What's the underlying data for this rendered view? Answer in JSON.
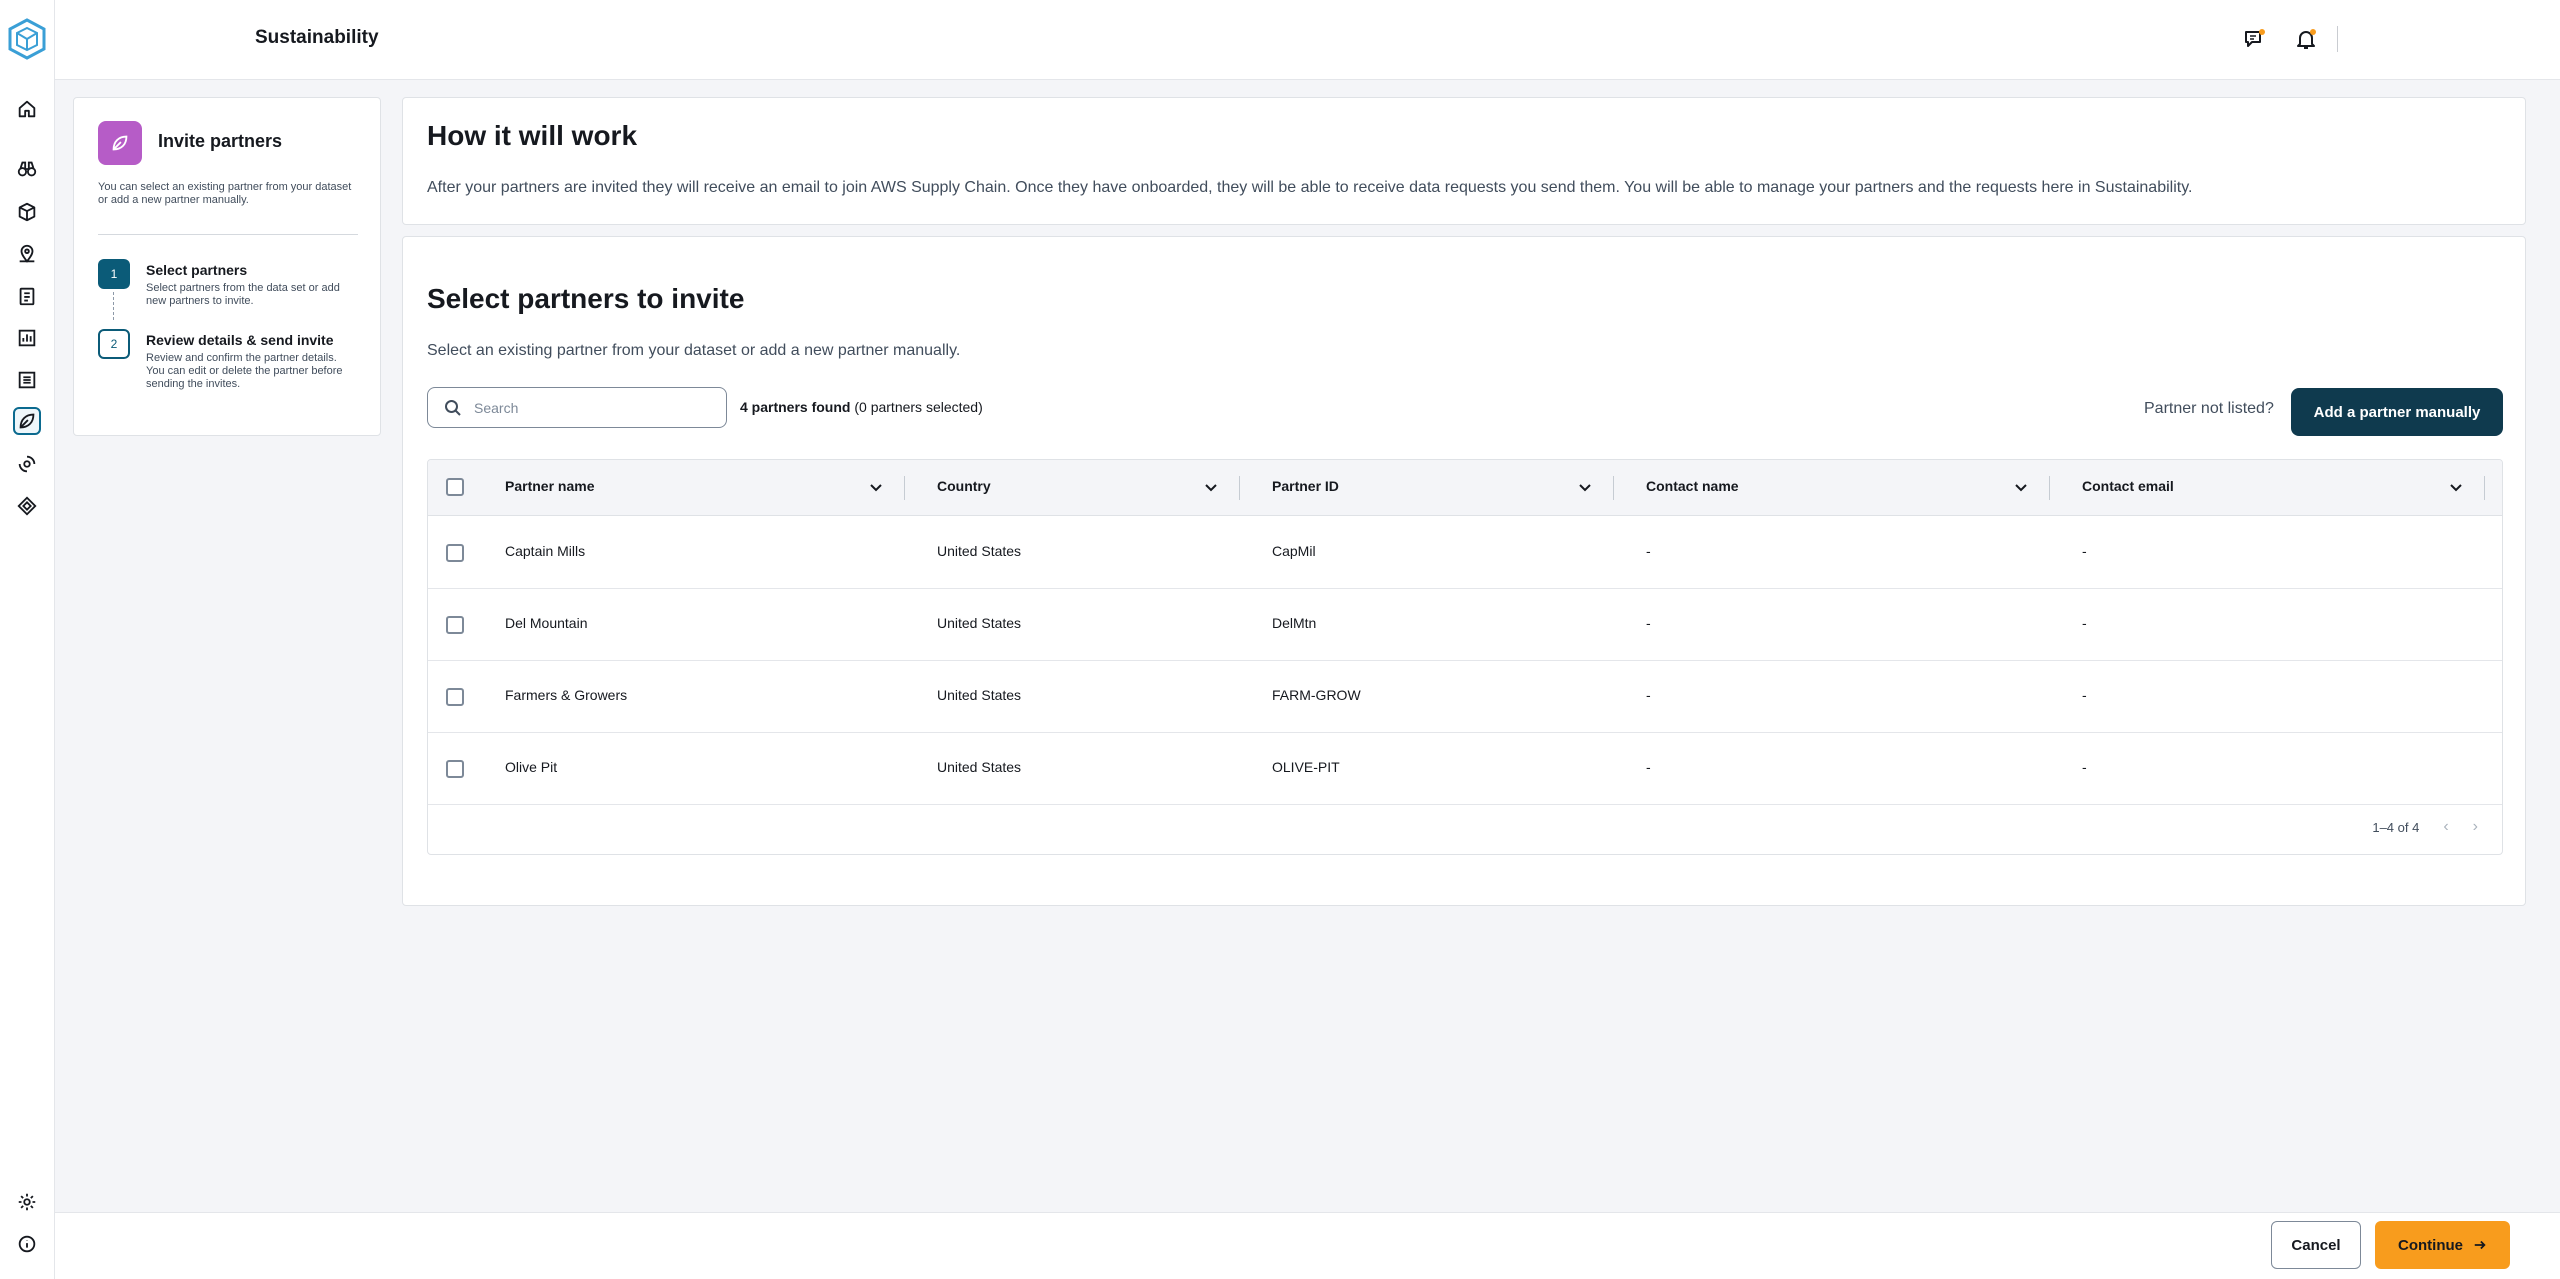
{
  "header": {
    "title": "Sustainability"
  },
  "rail": {
    "items": [
      "home-icon",
      "binoculars-icon",
      "box-icon",
      "map-pin-icon",
      "clipboard-icon",
      "chart-icon",
      "list-icon",
      "leaf-icon",
      "gear-flow-icon",
      "diamond-icon"
    ],
    "active": "leaf-icon",
    "bottom": [
      "settings-icon",
      "info-icon"
    ]
  },
  "wizard": {
    "title": "Invite partners",
    "description": "You can select an existing partner from your dataset or add a new partner manually.",
    "steps": [
      {
        "num": "1",
        "title": "Select partners",
        "desc": "Select partners from the data set or add new partners to invite."
      },
      {
        "num": "2",
        "title": "Review details & send invite",
        "desc": "Review and confirm the partner details. You can edit or delete the partner before sending the invites."
      }
    ]
  },
  "how": {
    "title": "How it will work",
    "text": "After your partners are invited they will receive an email to join AWS Supply Chain. Once they have onboarded, they will be able to receive data requests you send them. You will be able to manage your partners and the requests here in Sustainability."
  },
  "select": {
    "title": "Select partners to invite",
    "subtitle": "Select an existing partner from your dataset or add a new partner manually.",
    "search_placeholder": "Search",
    "found_bold": "4 partners found",
    "found_rest": " (0 partners selected)",
    "not_listed": "Partner not listed?",
    "add_button": "Add a partner manually"
  },
  "table": {
    "columns": [
      "Partner name",
      "Country",
      "Partner ID",
      "Contact name",
      "Contact email"
    ],
    "rows": [
      [
        "Captain Mills",
        "United States",
        "CapMil",
        "-",
        "-"
      ],
      [
        "Del Mountain",
        "United States",
        "DelMtn",
        "-",
        "-"
      ],
      [
        "Farmers & Growers",
        "United States",
        "FARM-GROW",
        "-",
        "-"
      ],
      [
        "Olive Pit",
        "United States",
        "OLIVE-PIT",
        "-",
        "-"
      ]
    ],
    "pagination": "1–4 of 4"
  },
  "footer": {
    "cancel": "Cancel",
    "continue": "Continue"
  },
  "colors": {
    "accent": "#0b5b78",
    "primary_button": "#0f3a4e",
    "continue": "#f89c1d",
    "wizard_icon": "#b65cc7"
  }
}
